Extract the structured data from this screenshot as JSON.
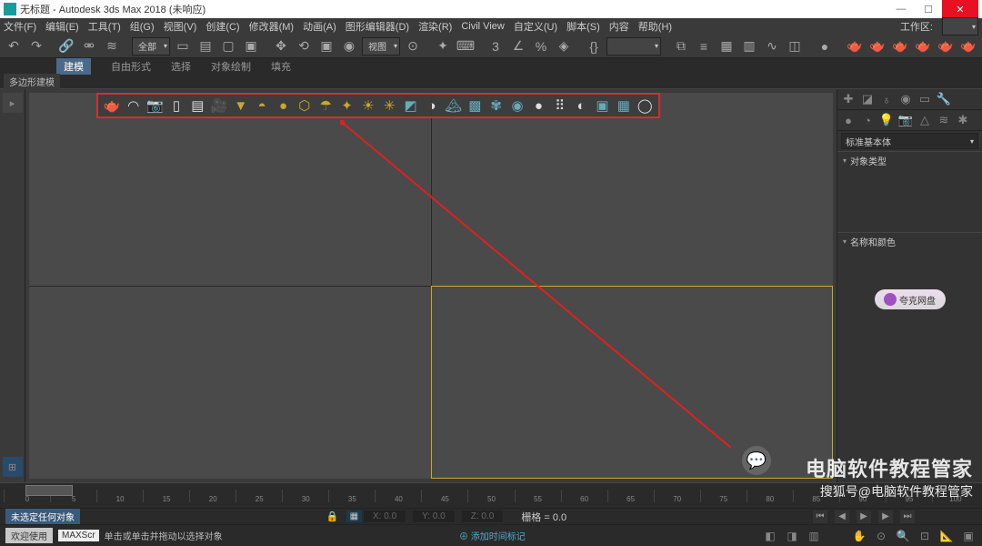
{
  "window": {
    "title": "无标题 - Autodesk 3ds Max 2018  (未响应)"
  },
  "menu": [
    "文件(F)",
    "编辑(E)",
    "工具(T)",
    "组(G)",
    "视图(V)",
    "创建(C)",
    "修改器(M)",
    "动画(A)",
    "图形编辑器(D)",
    "渲染(R)",
    "Civil View",
    "自定义(U)",
    "脚本(S)",
    "内容",
    "帮助(H)"
  ],
  "workspace_label": "工作区:",
  "toolbar": {
    "selset": "全部",
    "view": "视图"
  },
  "tabs": {
    "items": [
      "建模",
      "自由形式",
      "选择",
      "对象绘制",
      "填充"
    ],
    "active": 0
  },
  "subtab": "多边形建模",
  "rightpanel": {
    "dropdown": "标准基本体",
    "section1": "对象类型",
    "section2": "名称和颜色",
    "pill": "夸克网盘"
  },
  "timeline": {
    "ticks": [
      "0",
      "5",
      "10",
      "15",
      "20",
      "25",
      "30",
      "35",
      "40",
      "45",
      "50",
      "55",
      "60",
      "65",
      "70",
      "75",
      "80",
      "85",
      "90",
      "95",
      "100"
    ]
  },
  "status": {
    "empty_sel": "未选定任何对象",
    "coords": {
      "x": "X: 0.0",
      "y": "Y: 0.0",
      "z": "Z: 0.0"
    },
    "grid": "栅格 = 0.0",
    "welcome": "欢迎使用",
    "max": "MAXScr",
    "hint": "单击或单击并拖动以选择对象",
    "add_marker": "添加时间标记"
  },
  "watermark": {
    "line1": "电脑软件教程管家",
    "line2": "搜狐号@电脑软件教程管家"
  }
}
